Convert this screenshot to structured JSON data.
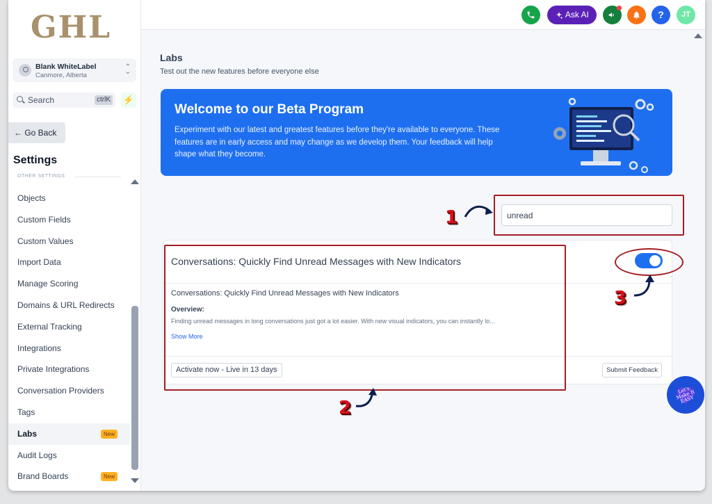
{
  "sidebar": {
    "logo": "GHL",
    "account": {
      "name": "Blank WhiteLabel",
      "location": "Canmore, Alberta"
    },
    "search": {
      "label": "Search",
      "shortcut": "ctrlK"
    },
    "go_back": "← Go Back",
    "heading": "Settings",
    "section_label": "OTHER SETTINGS",
    "items": [
      {
        "label": "Objects"
      },
      {
        "label": "Custom Fields"
      },
      {
        "label": "Custom Values"
      },
      {
        "label": "Import Data"
      },
      {
        "label": "Manage Scoring"
      },
      {
        "label": "Domains & URL Redirects"
      },
      {
        "label": "External Tracking"
      },
      {
        "label": "Integrations"
      },
      {
        "label": "Private Integrations"
      },
      {
        "label": "Conversation Providers"
      },
      {
        "label": "Tags"
      },
      {
        "label": "Labs",
        "badge": "New",
        "active": true
      },
      {
        "label": "Audit Logs"
      },
      {
        "label": "Brand Boards",
        "badge": "New"
      }
    ]
  },
  "header": {
    "ask_ai": "Ask AI",
    "help": "?",
    "user_initials": "JT"
  },
  "page": {
    "title": "Labs",
    "subtitle": "Test out the new features before everyone else"
  },
  "banner": {
    "title": "Welcome to our Beta Program",
    "body": "Experiment with our latest and greatest features before they're available to everyone. These features are in early access and may change as we develop them. Your feedback will help shape what they become."
  },
  "filter": {
    "value": "unread"
  },
  "feature": {
    "title": "Conversations: Quickly Find Unread Messages with New Indicators",
    "subtitle": "Conversations: Quickly Find Unread Messages with New Indicators",
    "overview_label": "Overview:",
    "overview_text": "Finding unread messages in long conversations just got a lot easier. With new visual indicators, you can instantly lo...",
    "show_more": "Show More",
    "activate": "Activate now - Live in 13 days",
    "feedback": "Submit Feedback",
    "enabled": true
  },
  "annotations": {
    "n1": "1",
    "n2": "2",
    "n3": "3"
  },
  "mascot": {
    "text": "Let's Make It EASY"
  },
  "colors": {
    "accent": "#1e6ff0",
    "annotation": "#a31d24",
    "brand_logo": "#a8916c"
  }
}
